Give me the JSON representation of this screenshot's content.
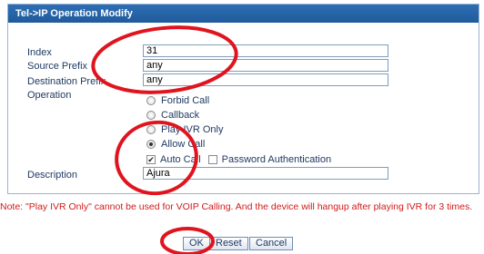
{
  "panel": {
    "title": "Tel->IP Operation Modify"
  },
  "form": {
    "index_label": "Index",
    "index_value": "31",
    "source_prefix_label": "Source Prefix",
    "source_prefix_value": "any",
    "destination_prefix_label": "Destination Prefix",
    "destination_prefix_value": "any",
    "operation_label": "Operation",
    "operation_options": [
      {
        "label": "Forbid Call",
        "selected": false
      },
      {
        "label": "Callback",
        "selected": false
      },
      {
        "label": "Play IVR Only",
        "selected": false
      },
      {
        "label": "Allow Call",
        "selected": true
      }
    ],
    "auto_call_label": "Auto Call",
    "auto_call_checked": true,
    "password_auth_label": "Password Authentication",
    "password_auth_checked": false,
    "description_label": "Description",
    "description_value": "Ajura"
  },
  "note": "Note: \"Play IVR Only\" cannot be used for VOIP Calling. And the device will hangup after playing IVR for 3 times.",
  "buttons": {
    "ok": "OK",
    "reset": "Reset",
    "cancel": "Cancel"
  },
  "colors": {
    "header": "#1f5a9c",
    "annotation": "#e0141e",
    "note": "#d11a1a"
  }
}
